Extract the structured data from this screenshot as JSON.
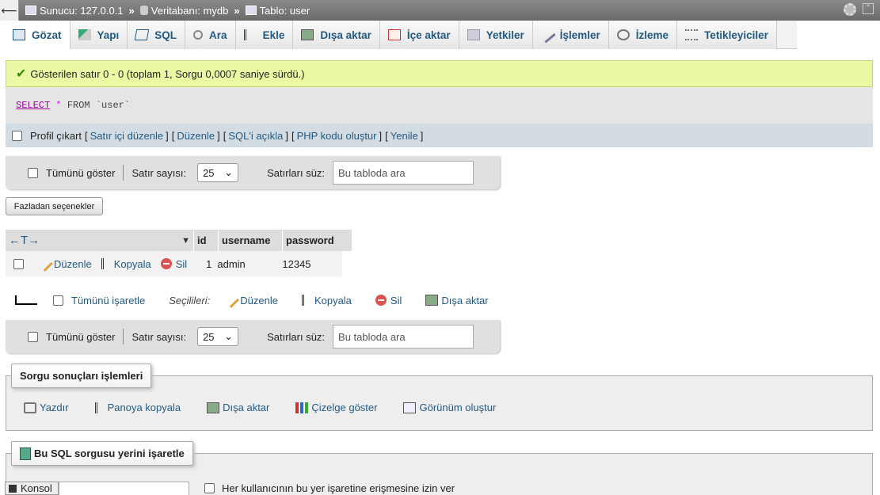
{
  "topbar": {
    "server": "Sunucu: 127.0.0.1",
    "database": "Veritabanı: mydb",
    "table": "Tablo: user",
    "sep": "»"
  },
  "tabs": [
    {
      "label": "Gözat",
      "icon": "browse-icon",
      "active": true
    },
    {
      "label": "Yapı",
      "icon": "structure-icon"
    },
    {
      "label": "SQL",
      "icon": "sql-icon"
    },
    {
      "label": "Ara",
      "icon": "search-icon"
    },
    {
      "label": "Ekle",
      "icon": "insert-icon"
    },
    {
      "label": "Dışa aktar",
      "icon": "export-icon"
    },
    {
      "label": "İçe aktar",
      "icon": "import-icon"
    },
    {
      "label": "Yetkiler",
      "icon": "privileges-icon"
    },
    {
      "label": "İşlemler",
      "icon": "operations-icon"
    },
    {
      "label": "İzleme",
      "icon": "tracking-icon"
    },
    {
      "label": "Tetikleyiciler",
      "icon": "triggers-icon"
    }
  ],
  "success_message": "Gösterilen satır 0 - 0 (toplam 1, Sorgu 0,0007 saniye sürdü.)",
  "sql": {
    "select": "SELECT",
    "star": "*",
    "from": "FROM",
    "table": "`user`"
  },
  "profile": {
    "label": "Profil çıkart",
    "lb": "[",
    "rb": "]",
    "links": [
      "Satır içi düzenle",
      "Düzenle",
      "SQL'i açıkla",
      "PHP kodu oluştur",
      "Yenile"
    ]
  },
  "nav": {
    "show_all": "Tümünü göster",
    "rows_label": "Satır sayısı:",
    "rows_value": "25",
    "filter_label": "Satırları süz:",
    "filter_placeholder": "Bu tabloda ara"
  },
  "more_options": "Fazladan seçenekler",
  "table": {
    "arrows": "←T→",
    "columns": [
      "id",
      "username",
      "password"
    ],
    "row": {
      "edit": "Düzenle",
      "copy": "Kopyala",
      "delete": "Sil",
      "id": "1",
      "username": "admin",
      "password": "12345"
    }
  },
  "bulk": {
    "check_all": "Tümünü işaretle",
    "selected": "Seçilileri:",
    "edit": "Düzenle",
    "copy": "Kopyala",
    "delete": "Sil",
    "export": "Dışa aktar"
  },
  "query_ops": {
    "legend": "Sorgu sonuçları işlemleri",
    "items": [
      "Yazdır",
      "Panoya kopyala",
      "Dışa aktar",
      "Çizelge göster",
      "Görünüm oluştur"
    ]
  },
  "bookmark": {
    "legend": "Bu SQL sorgusu yerini işaretle",
    "allow_all": "Her kullanıcının bu yer işaretine erişmesine izin ver"
  },
  "console": "Konsol"
}
